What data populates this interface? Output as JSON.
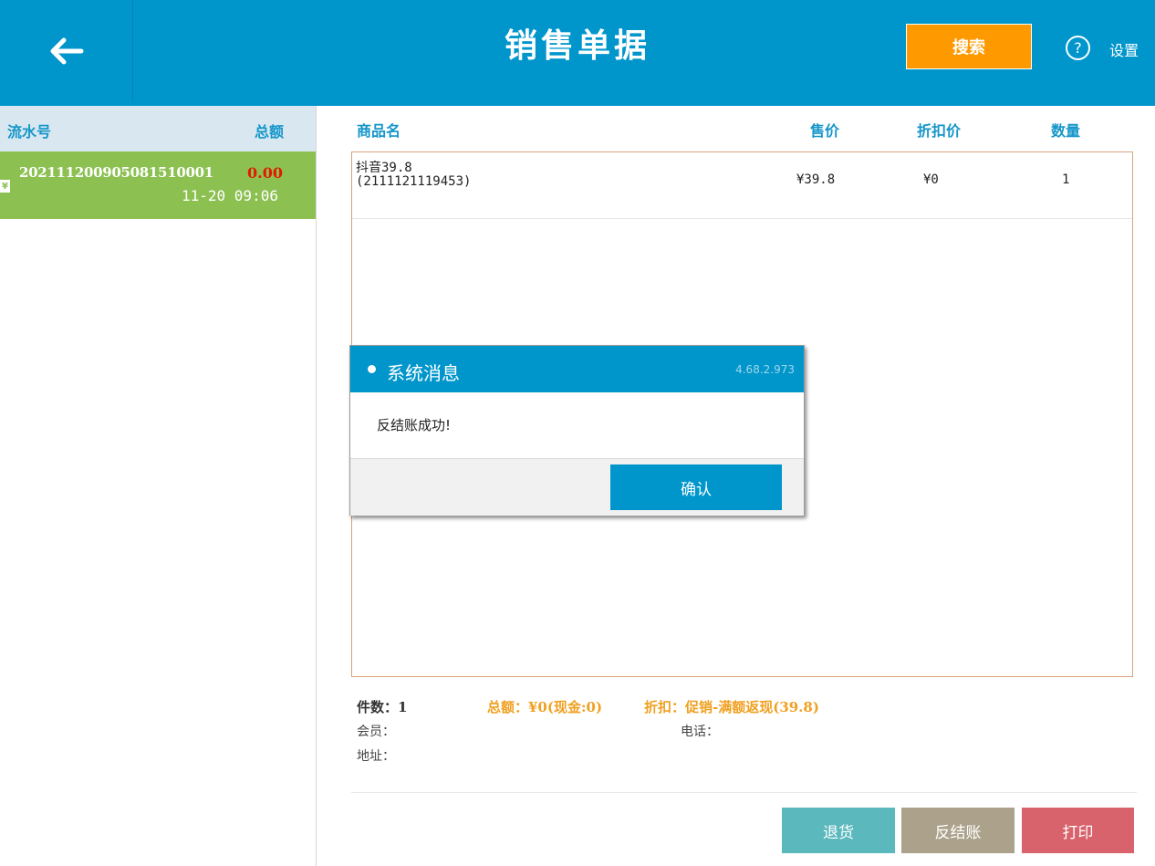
{
  "header": {
    "title": "销售单据",
    "back_icon": "arrow-left-icon",
    "search_label": "搜索",
    "help_icon_glyph": "?",
    "settings_label": "设置",
    "bg_color": "#0096cc",
    "search_color": "#ff9900"
  },
  "order_list": {
    "col_serial": "流水号",
    "col_total": "总额",
    "rows": [
      {
        "icon": "¥",
        "serial": "20211120090508151000​1",
        "amount": "0.00",
        "time": "11-20 09:06",
        "selected": true
      }
    ]
  },
  "items_table": {
    "headers": {
      "name": "商品名",
      "price": "售价",
      "discount_price": "折扣价",
      "qty": "数量"
    },
    "rows": [
      {
        "name": "抖音39.8",
        "code": "(2111121119453)",
        "price": "¥39.8",
        "discount_price": "¥0",
        "qty": "1"
      }
    ]
  },
  "summary": {
    "count": "件数：1",
    "total": "总额：¥0(现金:0)",
    "discount": "折扣：促销-满额返现(39.8)",
    "member": "会员：",
    "phone": "电话：",
    "address": "地址："
  },
  "actions": {
    "return_label": "退货",
    "reverse_label": "反结账",
    "print_label": "打印",
    "return_color": "#5bb8bd",
    "reverse_color": "#aca28c",
    "print_color": "#d8636c"
  },
  "dialog": {
    "title": "系统消息",
    "version": "4.68.2.973",
    "message": "反结账成功!",
    "confirm_label": "确认"
  }
}
